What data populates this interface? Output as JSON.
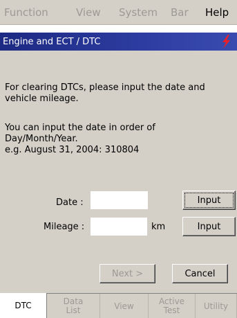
{
  "menu": {
    "items": [
      {
        "label": "Function",
        "enabled": false
      },
      {
        "label": "View",
        "enabled": false
      },
      {
        "label": "System",
        "enabled": false
      },
      {
        "label": "Bar",
        "enabled": false
      },
      {
        "label": "Help",
        "enabled": true
      }
    ]
  },
  "window": {
    "title": "Engine and ECT / DTC",
    "title_icon": "lightning-bolt-icon"
  },
  "message": {
    "line1": "For clearing DTCs, please input the date and vehicle mileage.",
    "line2": "You can input the date in order of Day/Month/Year.\ne.g. August 31, 2004:  310804"
  },
  "form": {
    "date_label": "Date :",
    "date_value": "",
    "mileage_label": "Mileage :",
    "mileage_value": "",
    "mileage_unit": "km",
    "input_button_date": "Input",
    "input_button_mileage": "Input"
  },
  "actions": {
    "next_label": "Next >",
    "cancel_label": "Cancel"
  },
  "tabs": [
    {
      "label": "DTC",
      "active": true
    },
    {
      "label": "Data\nList",
      "active": false
    },
    {
      "label": "View",
      "active": false
    },
    {
      "label": "Active\nTest",
      "active": false
    },
    {
      "label": "Utility",
      "active": false
    }
  ],
  "colors": {
    "title_bar": "#1d2a83",
    "panel": "#d4d0c8",
    "disabled_text": "#9c9a94",
    "bolt": "#e8202a"
  }
}
